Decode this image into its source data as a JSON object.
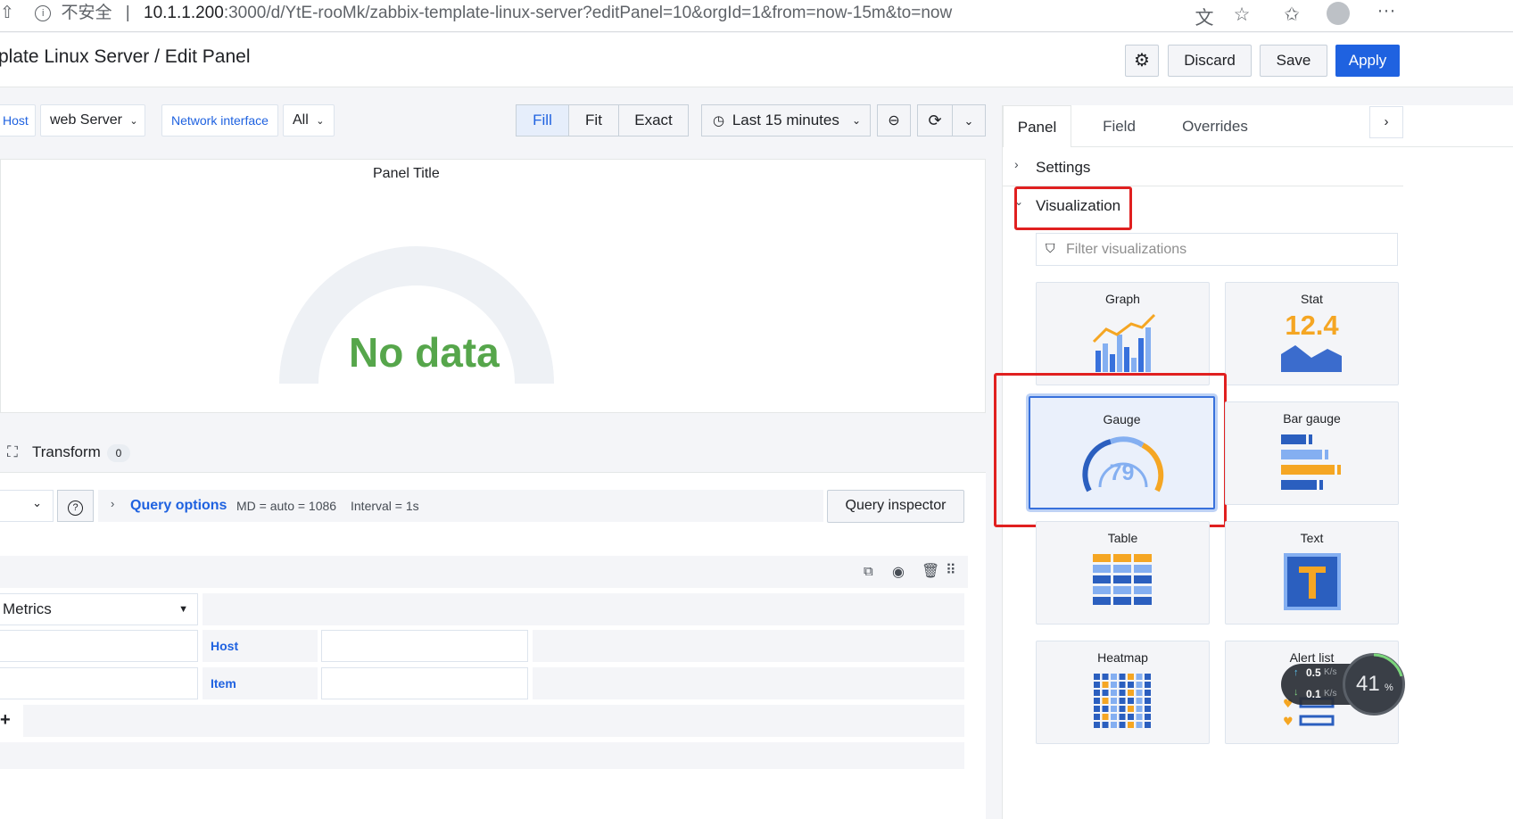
{
  "browser": {
    "security_icon": "info-circle-icon",
    "security_label": "不安全",
    "url_host": "10.1.1.200",
    "url_rest": ":3000/d/YtE-rooMk/zabbix-template-linux-server?editPanel=10&orgId=1&from=now-15m&to=now"
  },
  "header": {
    "title": "plate Linux Server / Edit Panel",
    "discard": "Discard",
    "save": "Save",
    "apply": "Apply"
  },
  "toolbar": {
    "host_label": "Host",
    "host_value": "web Server",
    "netif_label": "Network interface",
    "netif_value": "All",
    "fill": "Fill",
    "fit": "Fit",
    "exact": "Exact",
    "time_range": "Last 15 minutes"
  },
  "panel": {
    "title": "Panel Title",
    "no_data": "No data"
  },
  "query": {
    "transform_label": "Transform",
    "transform_count": "0",
    "options_label": "Query options",
    "md_info": "MD = auto = 1086",
    "interval_info": "Interval = 1s",
    "inspector": "Query inspector",
    "metrics_value": "Metrics",
    "host_label": "Host",
    "item_label": "Item",
    "add_symbol": "+"
  },
  "side": {
    "tabs": [
      "Panel",
      "Field",
      "Overrides"
    ],
    "settings": "Settings",
    "visualization": "Visualization",
    "filter_placeholder": "Filter visualizations",
    "cards": {
      "graph": "Graph",
      "stat": "Stat",
      "stat_value": "12.4",
      "gauge": "Gauge",
      "gauge_value": "79",
      "bargauge": "Bar gauge",
      "table": "Table",
      "text": "Text",
      "heatmap": "Heatmap",
      "alertlist": "Alert list"
    }
  },
  "netmon": {
    "up": "0.5",
    "down": "0.1",
    "unit": "K/s",
    "percent": "41",
    "percent_sign": "%"
  },
  "colors": {
    "accent": "#1f62e0",
    "nodata": "#56a64b",
    "highlight": "#e02020"
  }
}
